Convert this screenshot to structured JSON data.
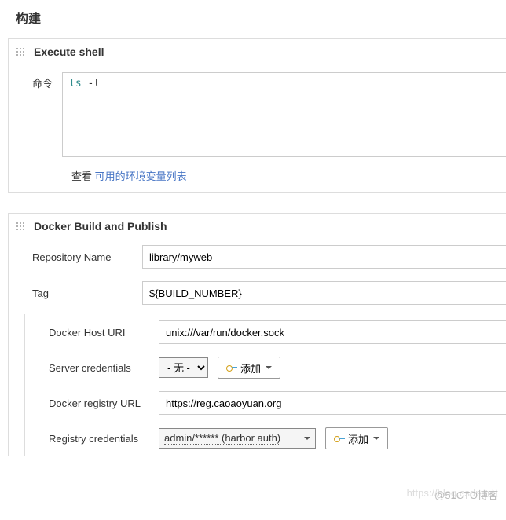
{
  "page": {
    "title": "构建"
  },
  "executeShell": {
    "title": "Execute shell",
    "commandLabel": "命令",
    "commandPart1": "ls",
    "commandPart2": " -l",
    "helperText": "查看 ",
    "helperLink": "可用的环境变量列表"
  },
  "dockerBuild": {
    "title": "Docker Build and Publish",
    "repoNameLabel": "Repository Name",
    "repoNameValue": "library/myweb",
    "tagLabel": "Tag",
    "tagValue": "${BUILD_NUMBER}",
    "dockerHostLabel": "Docker Host URI",
    "dockerHostValue": "unix:///var/run/docker.sock",
    "serverCredLabel": "Server credentials",
    "serverCredValue": "- 无 -",
    "addButton": "添加",
    "registryUrlLabel": "Docker registry URL",
    "registryUrlValue": "https://reg.caoaoyuan.org",
    "registryCredLabel": "Registry credentials",
    "registryCredValue": "admin/****** (harbor auth)"
  },
  "watermark": {
    "text1": "https://blog.csdn.net",
    "text2": "@51CTO博客"
  }
}
